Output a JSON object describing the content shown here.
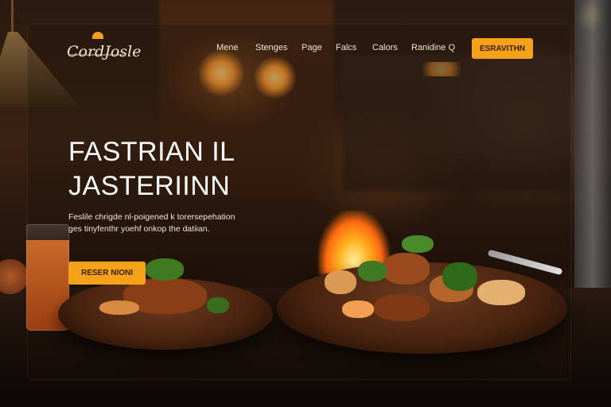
{
  "brand": {
    "logo_text": "CordJosle"
  },
  "nav": {
    "items": [
      "Mene",
      "Stenges",
      "Page",
      "Falcs",
      "Calors",
      "Ranidine Q"
    ],
    "cta_label": "ESRAVITHN"
  },
  "hero": {
    "title_line1": "FASTRIAN IL",
    "title_line2": "JASTERIINN",
    "desc_line1": "Feslile chrigde nl-poigened k torersepehation",
    "desc_line2": "ges tinyfenthr yoehf onkop the datiian.",
    "button_label": "RESER NIONI"
  },
  "colors": {
    "accent": "#f5a21a",
    "text": "#ffffff"
  }
}
